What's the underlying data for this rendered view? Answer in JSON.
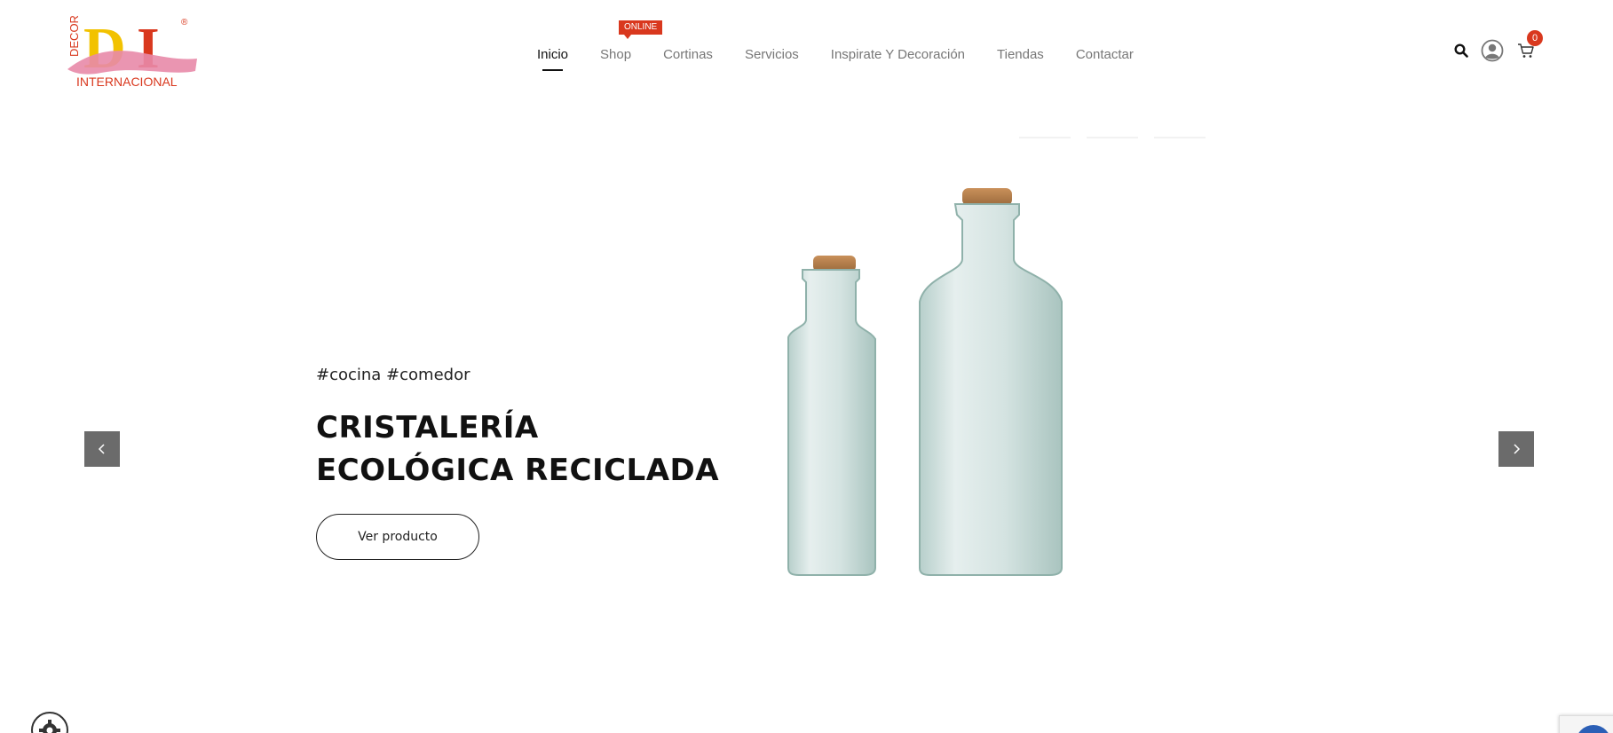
{
  "brand": {
    "logo_letters": "DI",
    "logo_side_text": "DECOR",
    "logo_bottom_text": "INTERNACIONAL",
    "logo_mark": "®"
  },
  "nav": {
    "items": [
      {
        "label": "Inicio",
        "active": true
      },
      {
        "label": "Shop",
        "active": false
      },
      {
        "label": "Cortinas",
        "active": false
      },
      {
        "label": "Servicios",
        "active": false
      },
      {
        "label": "Inspirate Y Decoración",
        "active": false
      },
      {
        "label": "Tiendas",
        "active": false
      },
      {
        "label": "Contactar",
        "active": false
      }
    ],
    "shop_badge": "ONLINE"
  },
  "header_icons": {
    "search": "search-icon",
    "user": "user-icon",
    "cart": "cart-icon",
    "cart_count": "0"
  },
  "hero": {
    "tags": "#cocina #comedor",
    "title_line1": "CRISTALERÍA",
    "title_line2": "ECOLÓGICA RECICLADA",
    "button_label": "Ver producto",
    "image": "glass-bottles-image"
  },
  "slider": {
    "prev": "chevron-left-icon",
    "next": "chevron-right-icon"
  },
  "colors": {
    "accent": "#d9381e",
    "text": "#111111",
    "nav_inactive": "#777777",
    "arrow_bg": "#6b6b6b"
  }
}
